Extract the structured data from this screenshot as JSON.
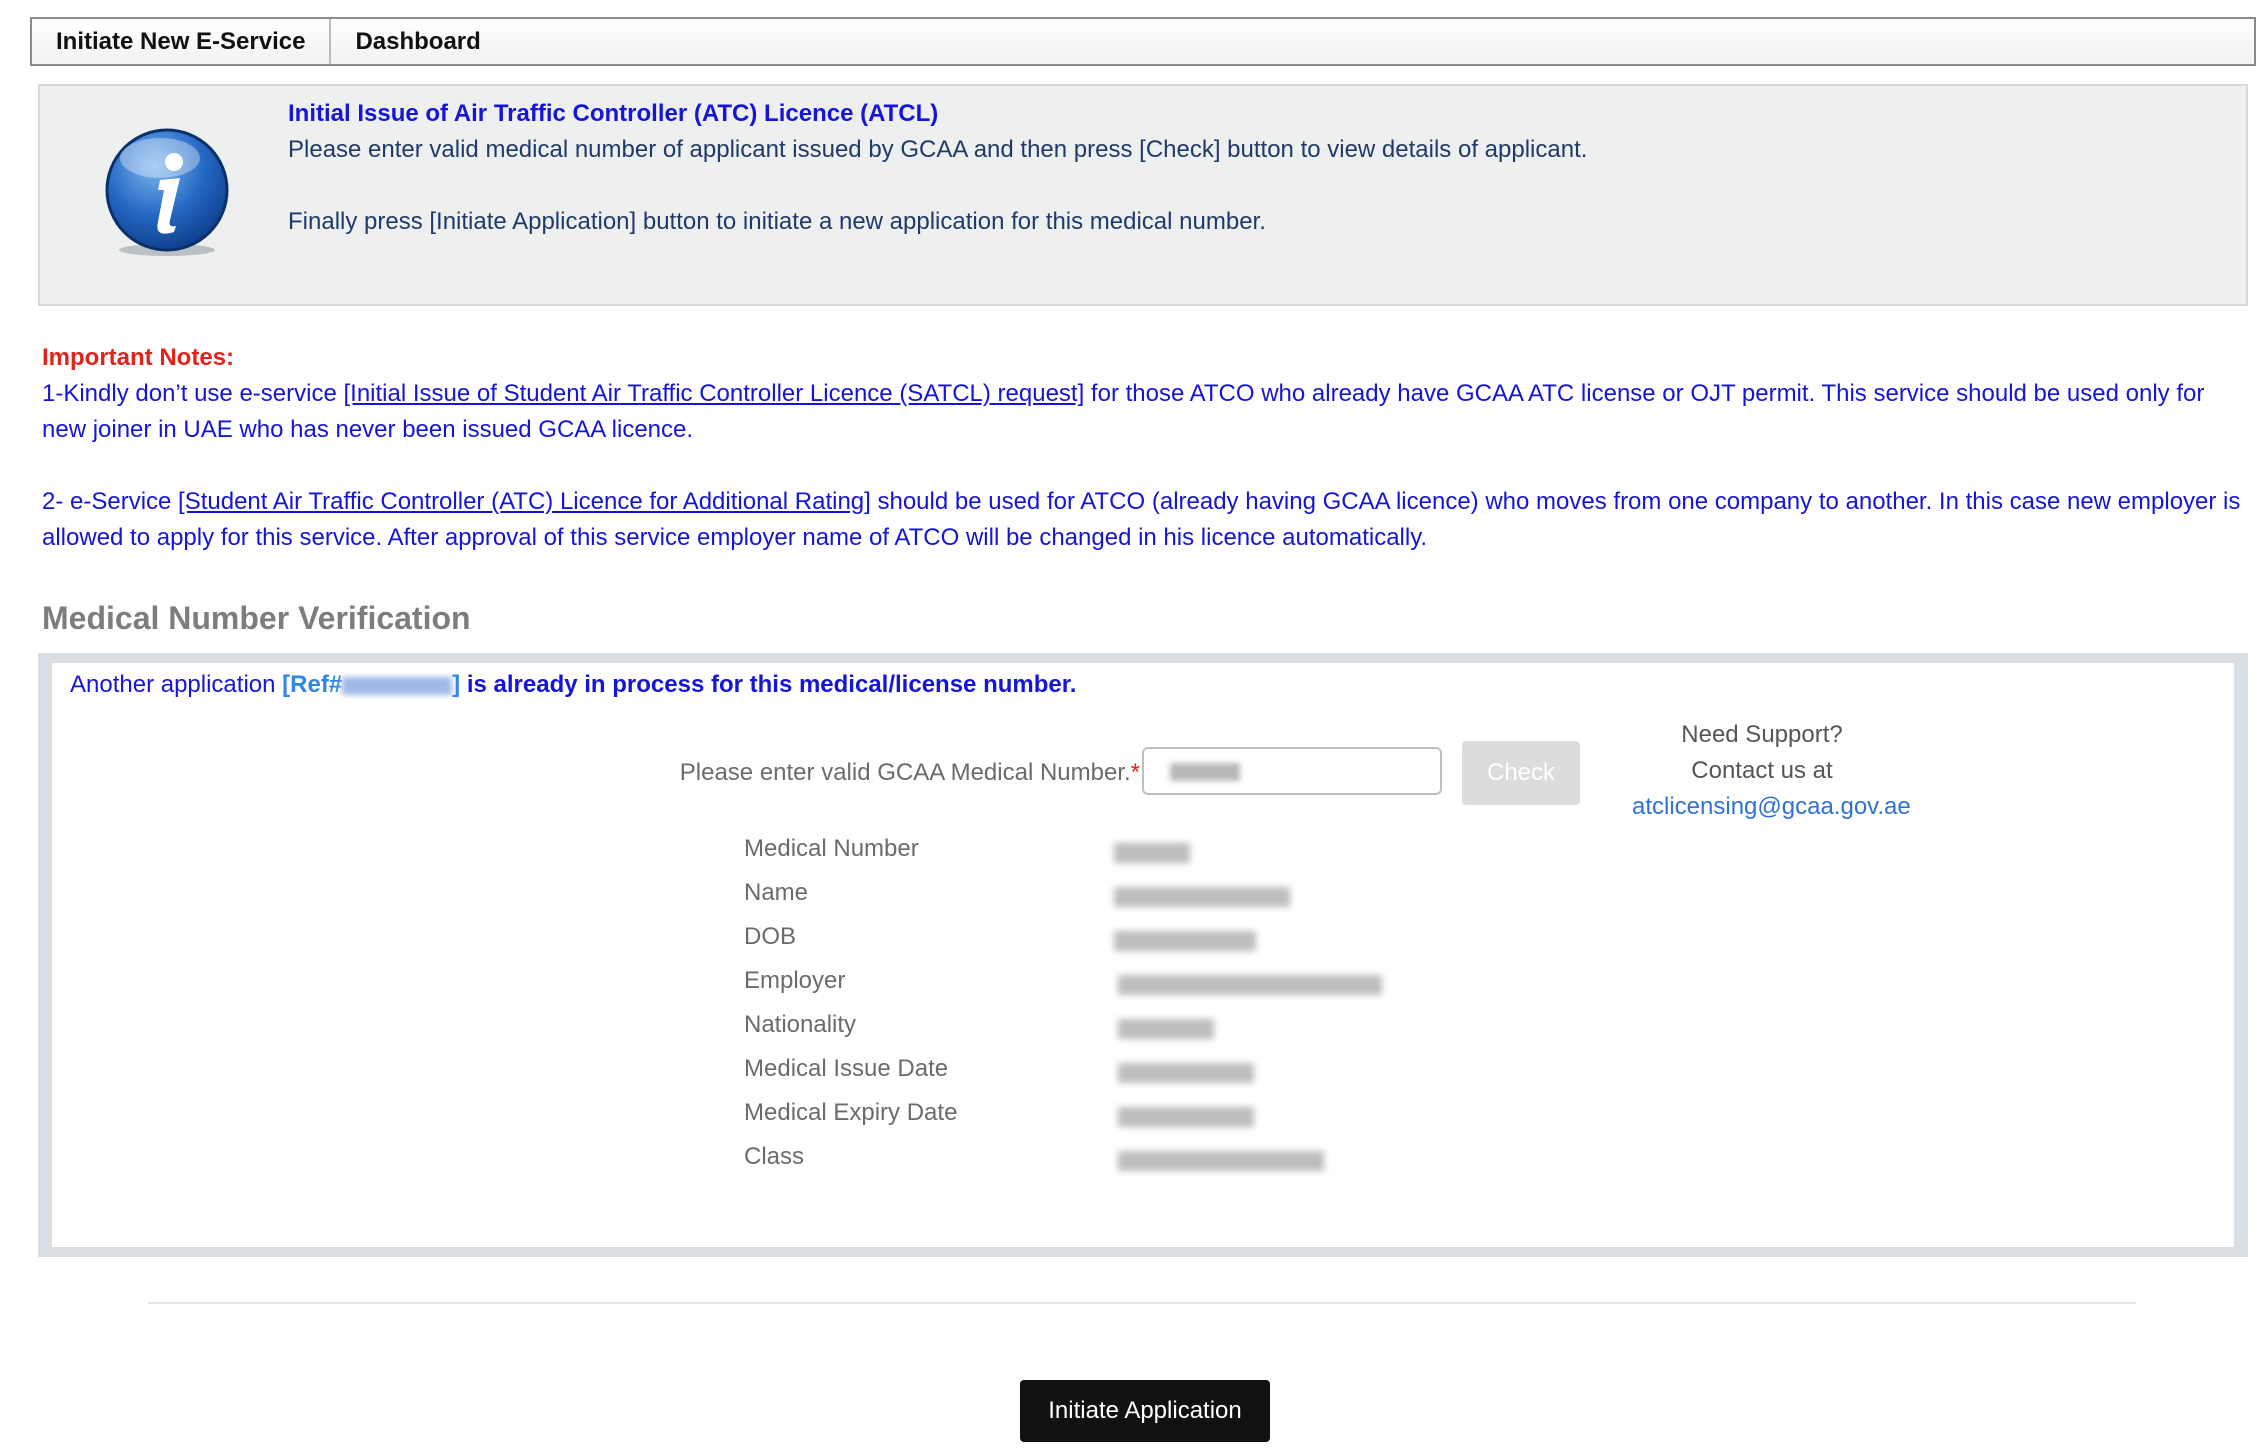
{
  "nav": {
    "tabs": [
      {
        "label": "Initiate New E-Service"
      },
      {
        "label": "Dashboard"
      }
    ]
  },
  "info": {
    "title": "Initial Issue of Air Traffic Controller (ATC) Licence (ATCL)",
    "line1": "Please enter valid medical number of applicant issued by GCAA and then press [Check] button to view details of applicant.",
    "line2": "Finally press [Initiate Application] button to initiate a new application for this medical number.",
    "icon": "info-icon"
  },
  "notes": {
    "heading": "Important Notes:",
    "note1_prefix": "1-Kindly don’t use e-service ",
    "note1_link": "[Initial Issue of Student Air Traffic Controller Licence (SATCL) request]",
    "note1_suffix": " for those ATCO who already have GCAA ATC license or OJT permit. This service should be used only for new joiner in UAE who has never been issued GCAA licence.",
    "note2_prefix": "2- e-Service ",
    "note2_link": "[Student Air Traffic Controller (ATC) Licence for Additional Rating]",
    "note2_suffix": " should be used for ATCO (already having GCAA licence) who moves from one company to another. In this case new employer is allowed to apply for this service. After approval of this service employer name of ATCO will be changed in his licence automatically."
  },
  "verification": {
    "section_title": "Medical Number Verification",
    "status_prefix": "Another application ",
    "status_ref_open": "[Ref#",
    "status_ref_close": "]",
    "status_suffix": " is already in process for this medical/license number.",
    "input_label": "Please enter valid GCAA Medical Number.",
    "required_mark": "*",
    "check_label": "Check",
    "support_line1": "Need Support?",
    "support_line2": "Contact us at",
    "support_email": "atclicensing@gcaa.gov.ae",
    "details": [
      {
        "label": "Medical Number"
      },
      {
        "label": "Name"
      },
      {
        "label": "DOB"
      },
      {
        "label": "Employer"
      },
      {
        "label": "Nationality"
      },
      {
        "label": "Medical Issue Date"
      },
      {
        "label": "Medical Expiry Date"
      },
      {
        "label": "Class"
      }
    ]
  },
  "footer": {
    "initiate_label": "Initiate Application"
  },
  "colors": {
    "accent_blue": "#1515d8",
    "alert_red": "#e0241b",
    "link_blue": "#2f72d6"
  }
}
